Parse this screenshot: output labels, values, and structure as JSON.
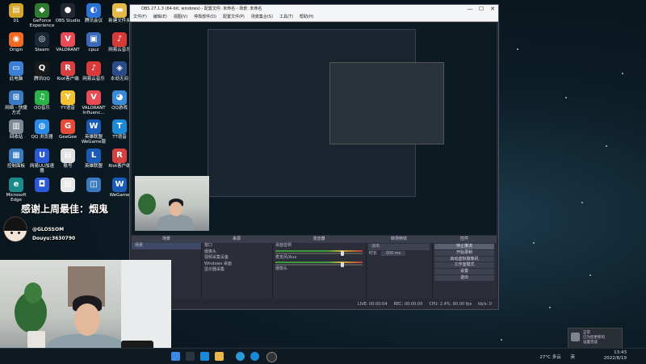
{
  "desktop_icons": [
    {
      "label": "01",
      "color": "#d4a62a",
      "glyph": "▤"
    },
    {
      "label": "GeForce Experience",
      "color": "#2f7a2f",
      "glyph": "◆"
    },
    {
      "label": "OBS Studio",
      "color": "#222831",
      "glyph": "●"
    },
    {
      "label": "腾讯会议",
      "color": "#2a72d8",
      "glyph": "◐"
    },
    {
      "label": "新建文件夹",
      "color": "#e5b84a",
      "glyph": "▬"
    },
    {
      "label": "Origin",
      "color": "#f06a23",
      "glyph": "◉"
    },
    {
      "label": "Steam",
      "color": "#1b2838",
      "glyph": "◎"
    },
    {
      "label": "VALORANT",
      "color": "#e84a56",
      "glyph": "V"
    },
    {
      "label": "cpuz",
      "color": "#3a6ab8",
      "glyph": "▣"
    },
    {
      "label": "网易云音乐",
      "color": "#d83a3a",
      "glyph": "♪"
    },
    {
      "label": "此电脑",
      "color": "#3b7fd6",
      "glyph": "▭"
    },
    {
      "label": "腾讯QQ",
      "color": "#1a1a1a",
      "glyph": "Q"
    },
    {
      "label": "Riot客户端",
      "color": "#d84040",
      "glyph": "R"
    },
    {
      "label": "网易云音乐",
      "color": "#d83a3a",
      "glyph": "♪"
    },
    {
      "label": "永劫无间",
      "color": "#2a4a8a",
      "glyph": "◈"
    },
    {
      "label": "网络 - 快捷方式",
      "color": "#3a7ac0",
      "glyph": "⊞"
    },
    {
      "label": "QQ音乐",
      "color": "#2ab24a",
      "glyph": "♫"
    },
    {
      "label": "YY语音",
      "color": "#f2c230",
      "glyph": "Y"
    },
    {
      "label": "VALORANT Influenc...",
      "color": "#e84a56",
      "glyph": "V"
    },
    {
      "label": "QQ游戏",
      "color": "#3a8ad8",
      "glyph": "◕"
    },
    {
      "label": "回收站",
      "color": "#7d8a95",
      "glyph": "▥"
    },
    {
      "label": "QQ 浏览器",
      "color": "#2a8ae8",
      "glyph": "◍"
    },
    {
      "label": "GeeGee",
      "color": "#e84a3a",
      "glyph": "G"
    },
    {
      "label": "英雄联盟 WeGame版",
      "color": "#1a5ab8",
      "glyph": "W"
    },
    {
      "label": "TT语音",
      "color": "#1a8ad8",
      "glyph": "T"
    },
    {
      "label": "控制面板",
      "color": "#3a7ac0",
      "glyph": "▦"
    },
    {
      "label": "网易UU加速器",
      "color": "#2a5ad8",
      "glyph": "U"
    },
    {
      "label": "账号",
      "color": "#e0e0e0",
      "glyph": "▤"
    },
    {
      "label": "英雄联盟",
      "color": "#1a5ab8",
      "glyph": "L"
    },
    {
      "label": "Riot客户端",
      "color": "#d84040",
      "glyph": "R"
    },
    {
      "label": "Microsoft Edge",
      "color": "#1a8a8a",
      "glyph": "e"
    },
    {
      "label": "",
      "color": "#2a5ad8",
      "glyph": "◘"
    },
    {
      "label": "",
      "color": "#e8e8e8",
      "glyph": "▤"
    },
    {
      "label": "",
      "color": "#3a7ac0",
      "glyph": "◫"
    },
    {
      "label": "WeGame",
      "color": "#1a5ab8",
      "glyph": "W"
    }
  ],
  "obs": {
    "title": "OBS 27.1.3 (64-bit, windows) - 配置文件: 未命名 - 场景: 未命名",
    "menu": [
      "文件(F)",
      "编辑(E)",
      "视图(V)",
      "停靠部件(D)",
      "配置文件(P)",
      "场景集合(S)",
      "工具(T)",
      "帮助(H)"
    ],
    "window_controls": [
      "—",
      "☐",
      "✕"
    ],
    "docks": {
      "scenes": {
        "header": "场景",
        "items": [
          "场景"
        ]
      },
      "sources": {
        "header": "来源",
        "items": [
          "窗口",
          "摄像头",
          "视频采集设备",
          "Windows 桌面",
          "显示器采集"
        ]
      },
      "mixer": {
        "header": "混音器",
        "channels": [
          {
            "name": "桌面音频",
            "db": "0.0 dB"
          },
          {
            "name": "麦克风/Aux",
            "db": "0.0 dB"
          },
          {
            "name": "摄像头",
            "db": "0.0 dB"
          }
        ]
      },
      "transitions": {
        "header": "转场特效",
        "type": "淡出",
        "duration_label": "时长",
        "duration": "300 ms"
      },
      "controls": {
        "header": "控件",
        "buttons": [
          "停止推流",
          "开始录制",
          "启动虚拟摄像机",
          "工作室模式",
          "设置",
          "退出"
        ]
      }
    },
    "status": {
      "live": "LIVE: 00:00:04",
      "rec": "REC: 00:00:00",
      "cpu": "CPU: 2.4%, 60.00 fps",
      "kbps": "kb/s: 0"
    },
    "scene_filter_label": "场景",
    "source_filter_label": "来源"
  },
  "overlay": {
    "text": "感谢上周最佳：烟鬼",
    "handle": "@GLOSSOM",
    "douyu": "Douyu:3630790"
  },
  "taskbar": {
    "weather": "27°C 多云",
    "lang": "英",
    "time": "13:43",
    "date": "2022/8/19"
  },
  "toast": {
    "lines": [
      "正常",
      "已为您更新的",
      "设置完成"
    ]
  },
  "colors": {
    "accent": "#3d4a66",
    "meter_green": "#3c9a3c",
    "meter_red": "#b83a3a"
  }
}
